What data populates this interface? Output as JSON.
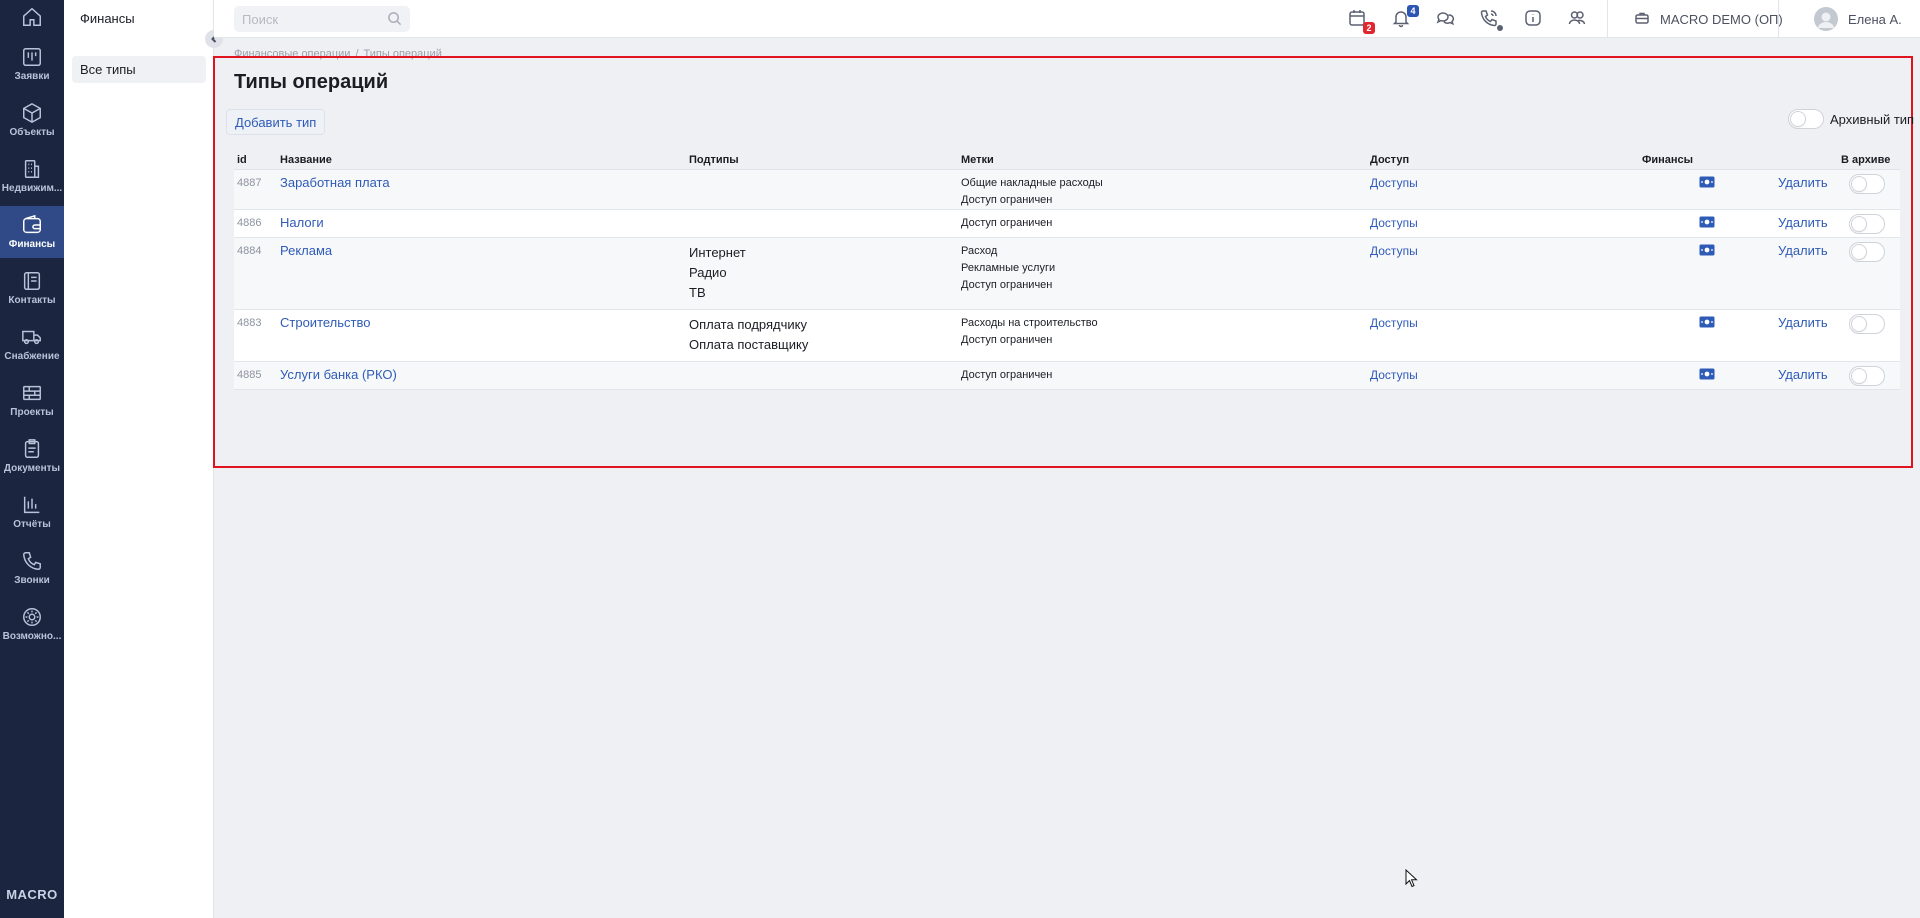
{
  "rail": {
    "items": [
      {
        "label": "Заявки",
        "icon": "kanban-icon"
      },
      {
        "label": "Объекты",
        "icon": "cube-icon"
      },
      {
        "label": "Недвижим...",
        "icon": "building-icon"
      },
      {
        "label": "Финансы",
        "icon": "wallet-icon",
        "active": true
      },
      {
        "label": "Контакты",
        "icon": "contacts-icon"
      },
      {
        "label": "Снабжение",
        "icon": "truck-icon"
      },
      {
        "label": "Проекты",
        "icon": "bricks-icon"
      },
      {
        "label": "Документы",
        "icon": "clipboard-icon"
      },
      {
        "label": "Отчёты",
        "icon": "bar-chart-icon"
      },
      {
        "label": "Звонки",
        "icon": "phone-icon"
      },
      {
        "label": "Возможно...",
        "icon": "gear-icon"
      }
    ],
    "brand": "MACRO"
  },
  "subside": {
    "title": "Финансы",
    "items": [
      "Все типы"
    ]
  },
  "topbar": {
    "search_placeholder": "Поиск",
    "calendar_badge": "2",
    "notifications_badge": "4",
    "company": "MACRO DEMO (ОП)",
    "user": "Елена А."
  },
  "breadcrumb": [
    "Финансовые операции",
    "Типы операций"
  ],
  "page": {
    "title": "Типы операций",
    "add_button": "Добавить тип",
    "archive_toggle_label": "Архивный тип"
  },
  "table": {
    "headers": {
      "id": "id",
      "name": "Название",
      "subtypes": "Подтипы",
      "tags": "Метки",
      "access": "Доступ",
      "finance": "Финансы",
      "archived": "В архиве"
    },
    "rows": [
      {
        "id": "4887",
        "name": "Заработная плата",
        "subtypes": [],
        "tags": [
          "Общие накладные расходы",
          "Доступ ограничен"
        ],
        "access": "Доступы",
        "delete": "Удалить",
        "archived": false
      },
      {
        "id": "4886",
        "name": "Налоги",
        "subtypes": [],
        "tags": [
          "Доступ ограничен"
        ],
        "access": "Доступы",
        "delete": "Удалить",
        "archived": false
      },
      {
        "id": "4884",
        "name": "Реклама",
        "subtypes": [
          "Интернет",
          "Радио",
          "ТВ"
        ],
        "tags": [
          "Расход",
          "Рекламные услуги",
          "Доступ ограничен"
        ],
        "access": "Доступы",
        "delete": "Удалить",
        "archived": false
      },
      {
        "id": "4883",
        "name": "Строительство",
        "subtypes": [
          "Оплата подрядчику",
          "Оплата поставщику"
        ],
        "tags": [
          "Расходы на строительство",
          "Доступ ограничен"
        ],
        "access": "Доступы",
        "delete": "Удалить",
        "archived": false
      },
      {
        "id": "4885",
        "name": "Услуги банка (РКО)",
        "subtypes": [],
        "tags": [
          "Доступ ограничен"
        ],
        "access": "Доступы",
        "delete": "Удалить",
        "archived": false
      }
    ]
  },
  "colors": {
    "rail_bg": "#1b2540",
    "rail_active": "#2f4a86",
    "link": "#2f5bb8",
    "highlight_frame": "#e0141e"
  }
}
